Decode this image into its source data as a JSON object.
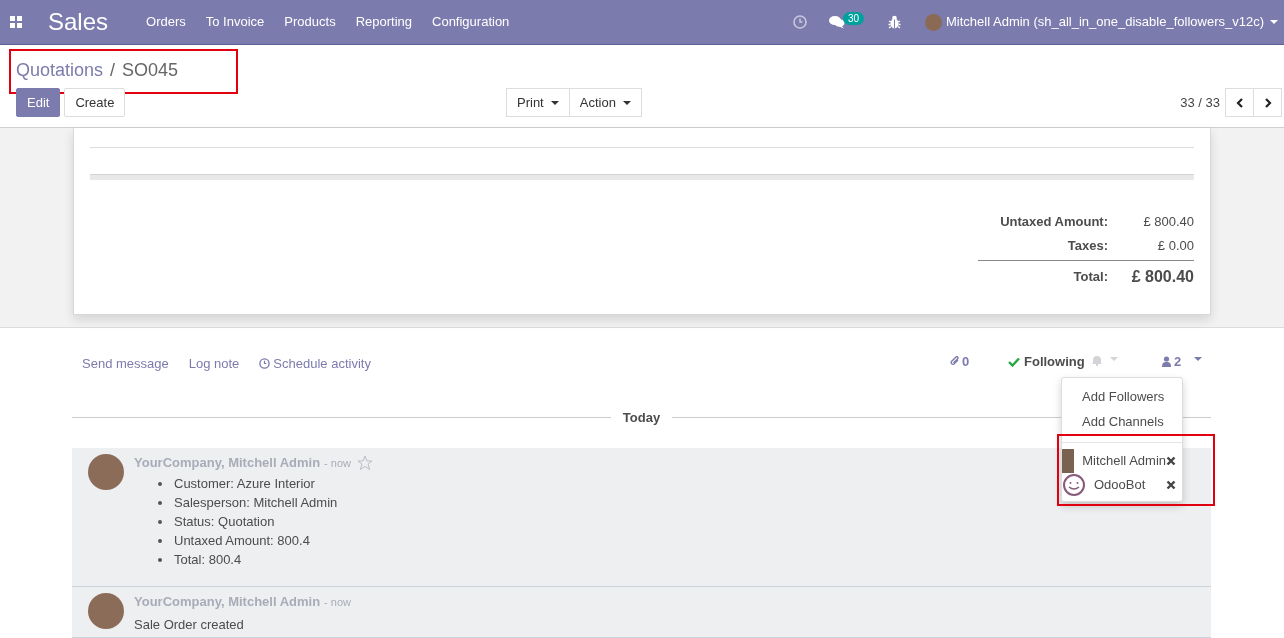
{
  "navbar": {
    "app": "Sales",
    "menu": [
      "Orders",
      "To Invoice",
      "Products",
      "Reporting",
      "Configuration"
    ],
    "messages_badge": "30",
    "user": "Mitchell Admin (sh_all_in_one_disable_followers_v12c)"
  },
  "breadcrumb": {
    "parent": "Quotations",
    "separator": "/",
    "current": "SO045",
    "highlighted": true
  },
  "buttons": [
    {
      "label": "Edit",
      "kind": "primary"
    },
    {
      "label": "Create",
      "kind": "secondary"
    }
  ],
  "dropdowns": [
    "Print",
    "Action"
  ],
  "pager": "33 / 33",
  "totals": [
    {
      "label": "Untaxed Amount:",
      "value": "£ 800.40",
      "kind": "line"
    },
    {
      "label": "Taxes:",
      "value": "£ 0.00",
      "kind": "line"
    },
    {
      "label": "Total:",
      "value": "£ 800.40",
      "kind": "total"
    }
  ],
  "chatter": {
    "actions": [
      {
        "label": "Send message",
        "kind": "text"
      },
      {
        "label": "Log note",
        "kind": "text"
      },
      {
        "label": "Schedule activity",
        "kind": "clock"
      }
    ],
    "attachments": "0",
    "following": {
      "label": "Following",
      "on": true
    },
    "followers_count": "2",
    "followers_menu": {
      "items": [
        "Add Followers",
        "Add Channels"
      ],
      "highlighted": true,
      "followers": [
        {
          "name": "Mitchell Admin",
          "kind": "person"
        },
        {
          "name": "OdooBot",
          "kind": "bot"
        }
      ]
    },
    "date_separator": "Today",
    "messages": [
      {
        "author": "YourCompany, Mitchell Admin",
        "time": "- now",
        "starred": false,
        "items": [
          "Customer: Azure Interior",
          "Salesperson: Mitchell Admin",
          "Status: Quotation",
          "Untaxed Amount: 800.4",
          "Total: 800.4"
        ]
      },
      {
        "author": "YourCompany, Mitchell Admin",
        "time": "- now",
        "body": "Sale Order created"
      }
    ]
  }
}
